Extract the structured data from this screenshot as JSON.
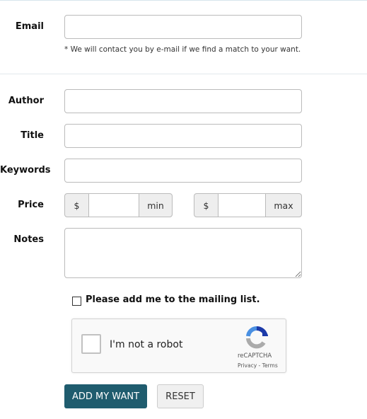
{
  "email": {
    "label": "Email",
    "value": "",
    "note": "* We will contact you by e-mail if we find a match to your want."
  },
  "fields": {
    "author": "Author",
    "title": "Title",
    "keywords": "Keywords",
    "price": "Price",
    "notes": "Notes"
  },
  "price": {
    "currency": "$",
    "min": "min",
    "max": "max",
    "min_value": "",
    "max_value": ""
  },
  "mailing_list": {
    "label": "Please add me to the mailing list.",
    "checked": false
  },
  "recaptcha": {
    "label": "I'm not a robot",
    "brand": "reCAPTCHA",
    "privacy": "Privacy",
    "sep": " - ",
    "terms": "Terms"
  },
  "buttons": {
    "submit": "ADD MY WANT",
    "reset": "RESET"
  },
  "colors": {
    "primary": "#1f5c6e"
  }
}
